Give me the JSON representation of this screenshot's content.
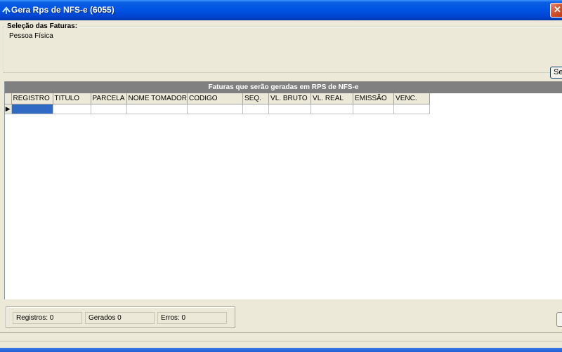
{
  "window": {
    "title": "Gera Rps de NFS-e (6055)",
    "close_label": "✕"
  },
  "selection_group": {
    "legend": "Seleção das Faturas:",
    "items": [
      "Pessoa Física"
    ],
    "button_label": "Selecionar"
  },
  "grid": {
    "caption": "Faturas que serão geradas em RPS de NFS-e",
    "indicator": "▶",
    "columns": [
      "REGISTRO",
      "TITULO",
      "PARCELA",
      "NOME TOMADOR",
      "CODIGO",
      "SEQ.",
      "VL. BRUTO",
      "VL. REAL",
      "EMISSÃO",
      "VENC."
    ],
    "rows": [
      [
        "",
        "",
        "",
        "",
        "",
        "",
        "",
        "",
        "",
        ""
      ]
    ]
  },
  "status": {
    "registros": "Registros:  0",
    "gerados": "Gerados  0",
    "erros": "Erros:  0"
  },
  "colors": {
    "titlebar": "#0055e5",
    "window_bg": "#ece9d8",
    "caption_bar": "#808080",
    "selected_cell": "#316ac5"
  }
}
